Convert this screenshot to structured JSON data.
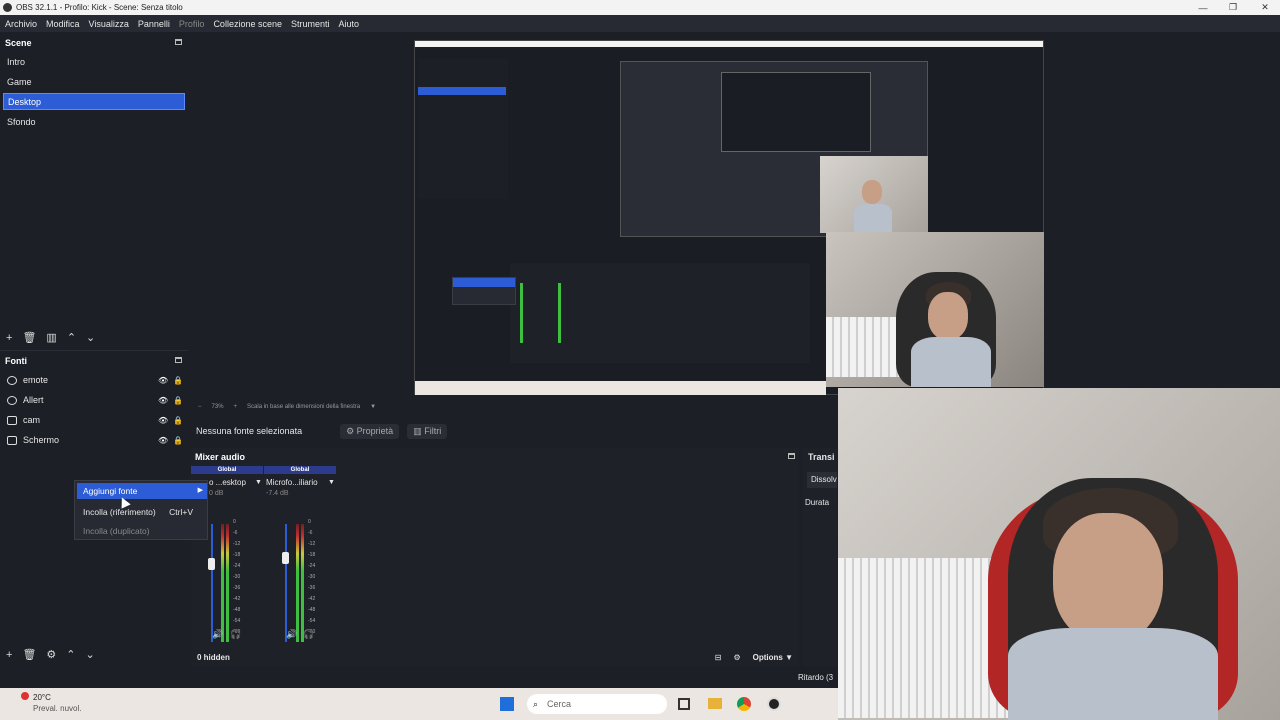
{
  "window": {
    "title": "OBS 32.1.1 - Profilo: Kick - Scene: Senza titolo"
  },
  "menu": [
    "Archivio",
    "Modifica",
    "Visualizza",
    "Pannelli",
    "Profilo",
    "Collezione scene",
    "Strumenti",
    "Aiuto"
  ],
  "scenes": {
    "header": "Scene",
    "items": [
      "Intro",
      "Game",
      "Desktop",
      "Sfondo"
    ],
    "selected": "Desktop"
  },
  "sources": {
    "header": "Fonti",
    "items": [
      "emote",
      "Allert",
      "cam",
      "Schermo"
    ]
  },
  "preview_bar": {
    "zoom": "73%",
    "scale_label": "Scala in base alle dimensioni della finestra"
  },
  "properties": {
    "none_selected": "Nessuna fonte selezionata",
    "properties_btn": "Proprietà",
    "filters_btn": "Filtri"
  },
  "mixer": {
    "header": "Mixer audio",
    "channels": [
      {
        "tag": "Global",
        "name": "o ...esktop",
        "db": "0 dB",
        "level": 0.55
      },
      {
        "tag": "Global",
        "name": "Microfo...iliario",
        "db": "-7.4 dB",
        "level": 0.8
      }
    ],
    "scale": [
      "0",
      "-6",
      "-12",
      "-18",
      "-24",
      "-30",
      "-36",
      "-42",
      "-48",
      "-54",
      "-60"
    ],
    "hidden": "0 hidden",
    "options": "Options"
  },
  "transitions": {
    "header": "Transi",
    "select": "Dissolv",
    "duration": "Durata"
  },
  "context_menu": [
    {
      "label": "Aggiungi fonte",
      "shortcut": ""
    },
    {
      "label": "Incolla (riferimento)",
      "shortcut": "Ctrl+V"
    },
    {
      "label": "Incolla (duplicato)",
      "shortcut": ""
    }
  ],
  "status": {
    "delay": "Ritardo (3"
  },
  "taskbar": {
    "weather_temp": "20°C",
    "weather_desc": "Preval. nuvol.",
    "search_placeholder": "Cerca"
  }
}
